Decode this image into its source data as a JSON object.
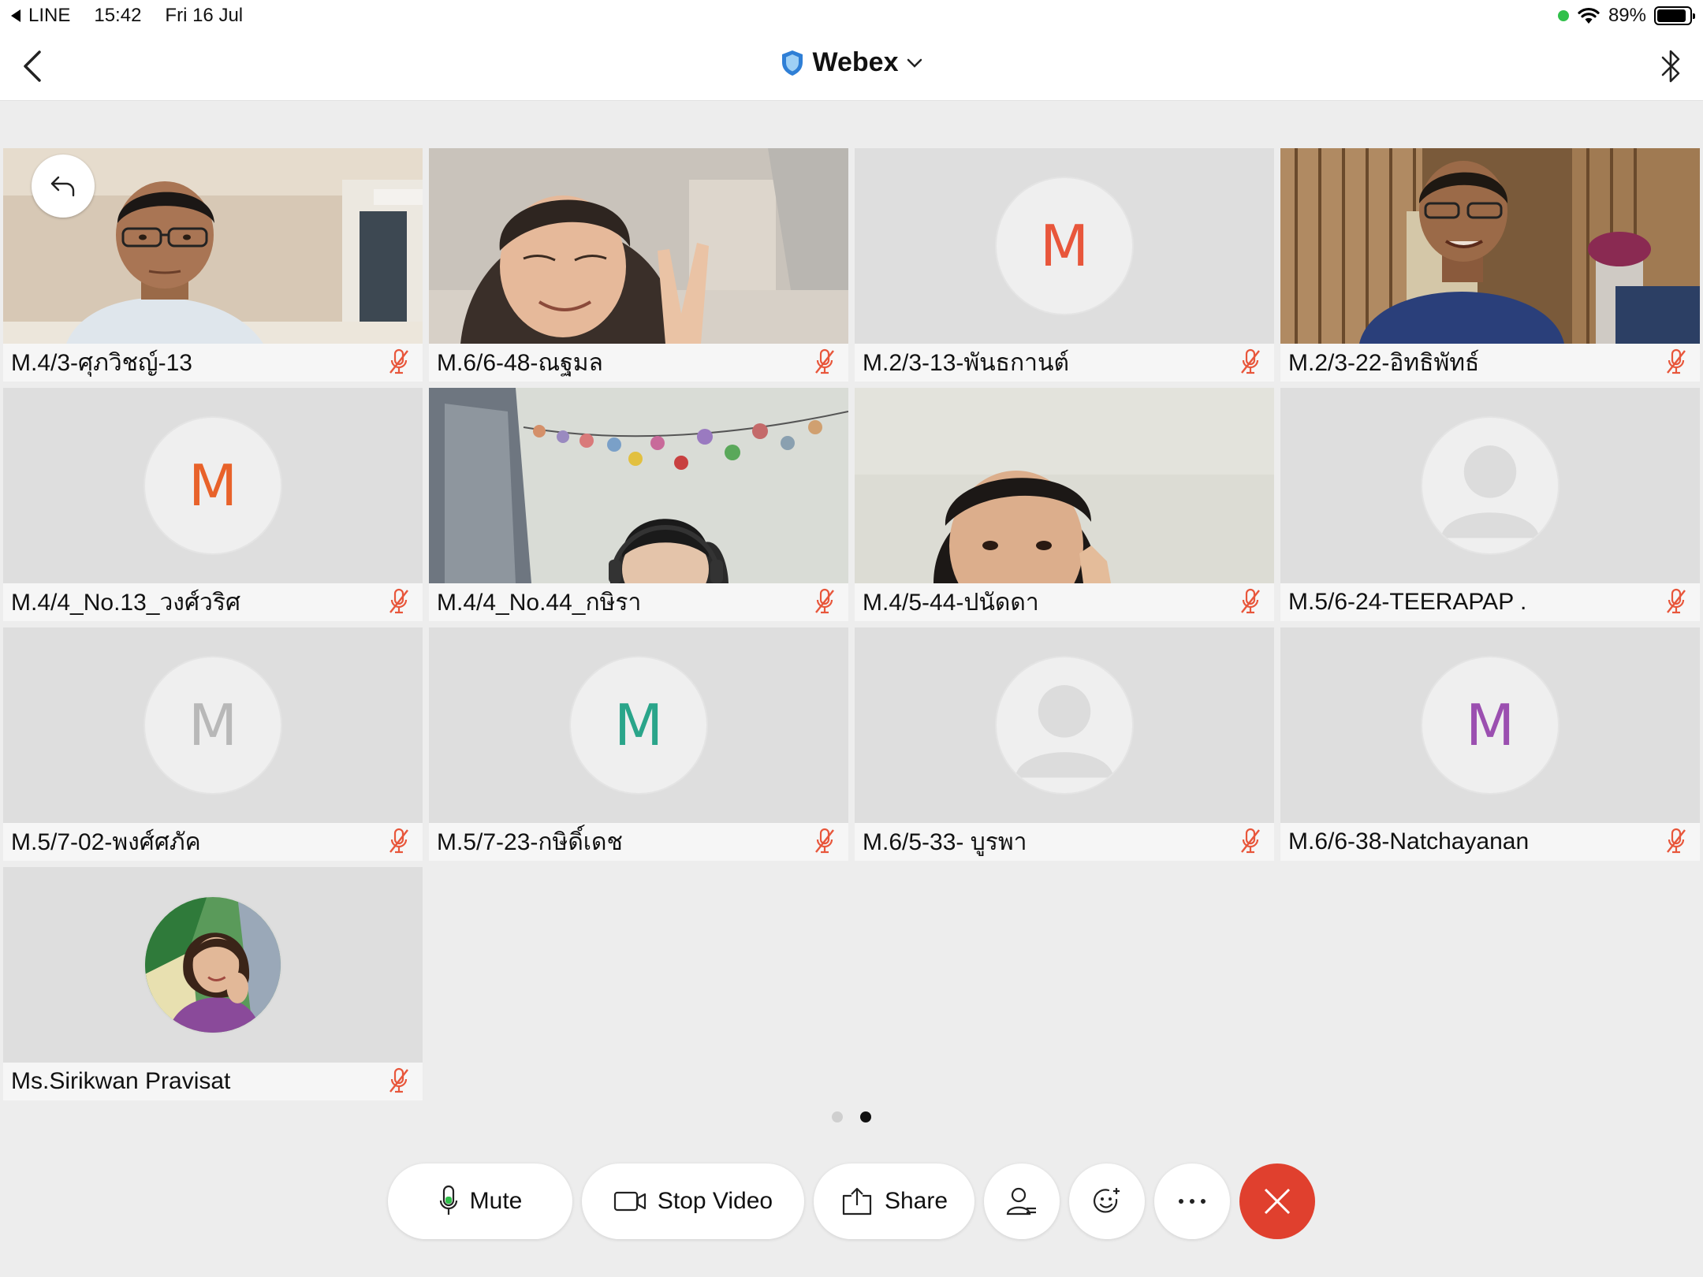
{
  "status_bar": {
    "back_app": "LINE",
    "time": "15:42",
    "date": "Fri 16 Jul",
    "battery": "89%",
    "battery_level": 0.89
  },
  "nav": {
    "title": "Webex"
  },
  "participants": [
    {
      "name": "M.4/3-ศุภวิชญ์-13",
      "type": "video"
    },
    {
      "name": "M.6/6-48-ณฐมล",
      "type": "video"
    },
    {
      "name": "M.2/3-13-พันธกานต์",
      "type": "initial",
      "initial": "M",
      "color": "#e8563b"
    },
    {
      "name": "M.2/3-22-อิทธิพัทธ์",
      "type": "video"
    },
    {
      "name": "M.4/4_No.13_วงศ์วริศ",
      "type": "initial",
      "initial": "M",
      "color": "#e8622a"
    },
    {
      "name": "M.4/4_No.44_กษิรา",
      "type": "video"
    },
    {
      "name": "M.4/5-44-ปนัดดา",
      "type": "video"
    },
    {
      "name": "M.5/6-24-TEERAPAP .",
      "type": "silhouette"
    },
    {
      "name": "M.5/7-02-พงศ์ศภัค",
      "type": "initial",
      "initial": "M",
      "color": "#b8b8b8"
    },
    {
      "name": "M.5/7-23-กษิดิ์เดช",
      "type": "initial",
      "initial": "M",
      "color": "#2aa58a"
    },
    {
      "name": "M.6/5-33- บูรพา",
      "type": "silhouette"
    },
    {
      "name": "M.6/6-38-Natchayanan",
      "type": "initial",
      "initial": "M",
      "color": "#9b4fb0"
    },
    {
      "name": "Ms.Sirikwan Pravisat",
      "type": "photo"
    }
  ],
  "pagination": {
    "current_page": 2,
    "total_pages": 2
  },
  "controls": {
    "mute_label": "Mute",
    "video_label": "Stop Video",
    "share_label": "Share"
  },
  "colors": {
    "end_call": "#e0402e",
    "muted_mic": "#e8563b",
    "mic_level": "#30c04a",
    "shield": "#2f7fd6"
  }
}
